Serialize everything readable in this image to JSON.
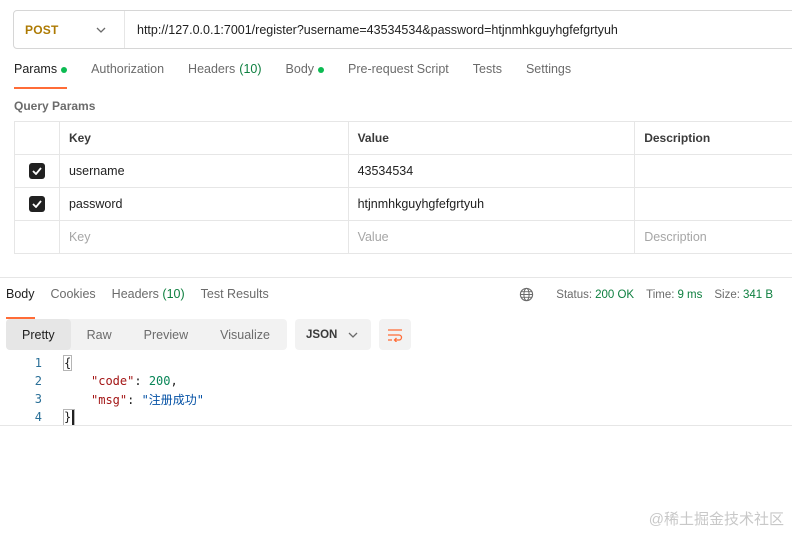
{
  "request": {
    "method": "POST",
    "url": "http://127.0.0.1:7001/register?username=43534534&password=htjnmhkguyhgfefgrtyuh"
  },
  "request_tabs": [
    {
      "label": "Params",
      "active": true,
      "dot": true
    },
    {
      "label": "Authorization"
    },
    {
      "label": "Headers",
      "count": "(10)"
    },
    {
      "label": "Body",
      "dot": true
    },
    {
      "label": "Pre-request Script"
    },
    {
      "label": "Tests"
    },
    {
      "label": "Settings"
    }
  ],
  "query_params": {
    "title": "Query Params",
    "headers": {
      "key": "Key",
      "value": "Value",
      "description": "Description"
    },
    "rows": [
      {
        "key": "username",
        "value": "43534534",
        "description": "",
        "checked": true
      },
      {
        "key": "password",
        "value": "htjnmhkguyhgfefgrtyuh",
        "description": "",
        "checked": true
      }
    ],
    "placeholders": {
      "key": "Key",
      "value": "Value",
      "description": "Description"
    }
  },
  "response_tabs": [
    {
      "label": "Body",
      "active": true
    },
    {
      "label": "Cookies"
    },
    {
      "label": "Headers",
      "count": "(10)"
    },
    {
      "label": "Test Results"
    }
  ],
  "status": {
    "status_label": "Status:",
    "status_value": "200 OK",
    "time_label": "Time:",
    "time_value": "9 ms",
    "size_label": "Size:",
    "size_value": "341 B"
  },
  "view_modes": [
    "Pretty",
    "Raw",
    "Preview",
    "Visualize"
  ],
  "active_view": "Pretty",
  "format": "JSON",
  "code_lines": [
    {
      "num": "1",
      "text": "{"
    },
    {
      "num": "2",
      "key": "\"code\"",
      "value": "200",
      "sep": ": ",
      "trail": ","
    },
    {
      "num": "3",
      "key": "\"msg\"",
      "value": "\"注册成功\"",
      "sep": ": ",
      "trail": ""
    },
    {
      "num": "4",
      "text": "}"
    }
  ],
  "watermark": "@稀土掘金技术社区",
  "colors": {
    "accent": "#ff6c37",
    "method": "#ad7a03",
    "status_ok": "#0d7f3f"
  }
}
